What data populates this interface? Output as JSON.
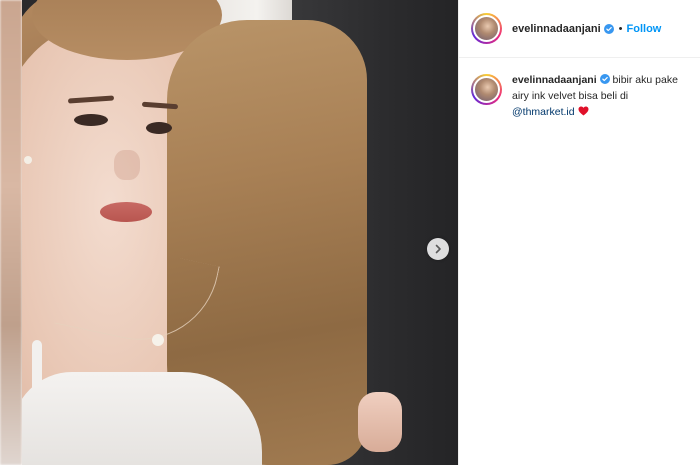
{
  "post": {
    "username": "evelinnadaanjani",
    "verified": true,
    "separator": "•",
    "follow_label": "Follow"
  },
  "caption": {
    "username": "evelinnadaanjani",
    "text": "bibir aku pake airy ink velvet bisa beli di",
    "mention": "@thmarket.id",
    "emoji": "heart-icon"
  },
  "media": {
    "next_icon": "chevron-right-icon"
  },
  "colors": {
    "link": "#0095f6",
    "mention": "#00376b",
    "verified": "#3897f0",
    "heart": "#e0102a"
  }
}
